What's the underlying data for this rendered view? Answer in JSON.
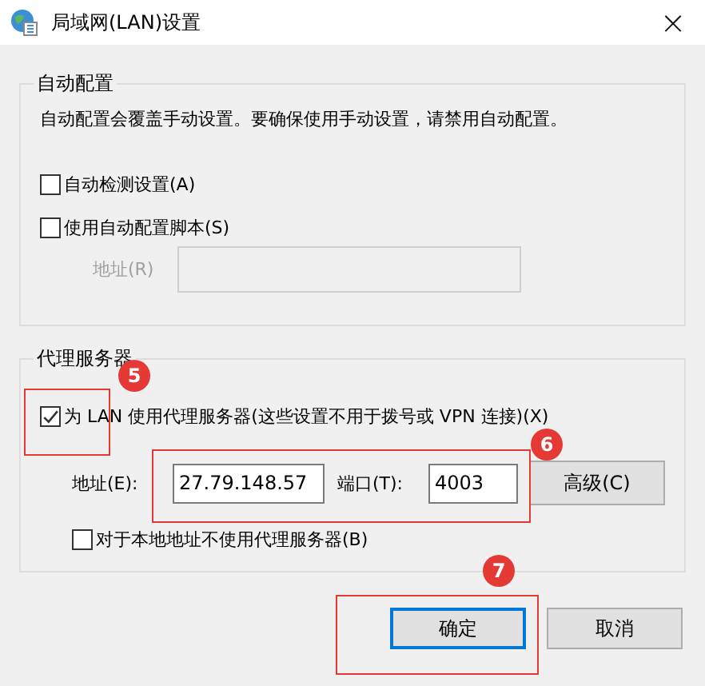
{
  "window": {
    "title": "局域网(LAN)设置",
    "close": "×"
  },
  "auto_config": {
    "title": "自动配置",
    "description": "自动配置会覆盖手动设置。要确保使用手动设置，请禁用自动配置。",
    "options": [
      {
        "label": "自动检测设置(A)",
        "checked": false
      },
      {
        "label": "使用自动配置脚本(S)",
        "checked": false
      }
    ],
    "address": {
      "label": "地址(R)",
      "disabled": true
    }
  },
  "proxy": {
    "title": "代理服务器",
    "use_proxy": {
      "label": "为 LAN 使用代理服务器(这些设置不用于拨号或 VPN 连接)(X)",
      "checked": true
    },
    "address_label": "地址(E):",
    "address": "27.79.148.57",
    "port_label": "端口(T):",
    "port": "4003",
    "advanced": "高级(C)",
    "bypass_local": {
      "label": "对于本地地址不使用代理服务器(B)",
      "checked": false
    }
  },
  "buttons": [
    {
      "label": "确定",
      "selected": true
    },
    {
      "label": "取消",
      "selected": false
    }
  ],
  "annotations": [
    {
      "label": "5"
    },
    {
      "label": "6"
    },
    {
      "label": "7"
    }
  ]
}
